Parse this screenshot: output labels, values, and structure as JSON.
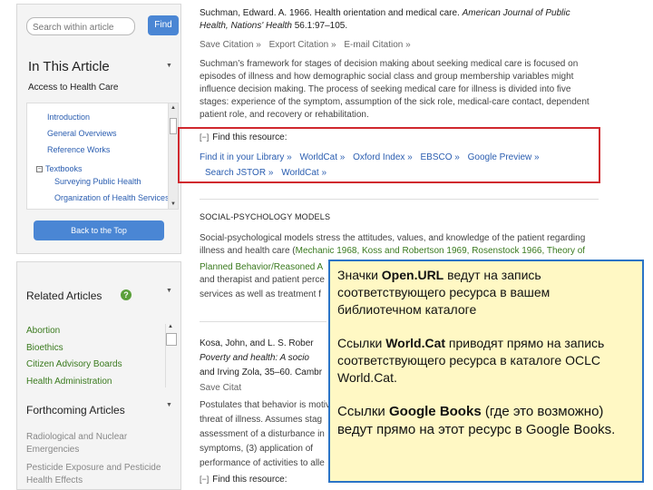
{
  "sidebar": {
    "search": {
      "placeholder": "Search within article",
      "button": "Find"
    },
    "article": {
      "heading": "In This Article",
      "subheading": "Access to Health Care",
      "toc": [
        {
          "label": "Introduction"
        },
        {
          "label": "General Overviews"
        },
        {
          "label": "Reference Works"
        },
        {
          "label": "Textbooks"
        },
        {
          "label": "Surveying Public Health"
        },
        {
          "label": "Organization of Health Services"
        }
      ],
      "back_to_top": "Back to the Top"
    },
    "related": {
      "heading": "Related Articles",
      "items": [
        "Abortion",
        "Bioethics",
        "Citizen Advisory Boards",
        "Health Administration"
      ],
      "forthcoming_heading": "Forthcoming Articles",
      "forthcoming_items": [
        "Radiological and Nuclear Emergencies",
        "Pesticide Exposure and Pesticide Health Effects"
      ]
    }
  },
  "main": {
    "ref1": {
      "text_a": "Suchman, Edward. A. 1966. Health orientation and medical care. ",
      "text_b": "American Journal of Public Health, Nations' Health",
      "text_c": " 56.1:97–105."
    },
    "actions": [
      "Save Citation »",
      "Export Citation »",
      "E-mail Citation »"
    ],
    "para1": "Suchman’s framework for stages of decision making about seeking medical care is focused on episodes of illness and how demographic social class and group membership variables might influence decision making. The process of seeking medical care for illness is divided into five stages: experience of the symptom, assumption of the sick role, medical-care contact, dependent patient role, and recovery or rehabilitation.",
    "find_resource": "Find this resource:",
    "resource_links": [
      "Find it in your Library »",
      "WorldCat »",
      "Oxford Index »",
      "EBSCO »",
      "Google Preview »",
      "Search JSTOR »",
      "WorldCat »"
    ],
    "section_title": "SOCIAL-PSYCHOLOGY MODELS",
    "para2_a": "Social-psychological models stress the attitudes, values, and knowledge of the patient regarding illness and health care (",
    "para2_link": "Mechanic 1968, Koss and Robertson 1969, Rosenstock 1966, Theory of",
    "para2_line3": "Planned Behavior/Reasoned A",
    "para2_line4": "and therapist and patient perce",
    "para2_line5": "services as well as treatment f",
    "ref2_a": "Kosa, John, and L. S. Rober",
    "ref2_b": "Poverty and health: A socio",
    "ref2_c": "and Irving Zola, 35–60. Cambr",
    "ref2_action": "Save Citat",
    "para3_lines": [
      "Postulates that behavior is motiv",
      "threat of illness. Assumes stag",
      "assessment of a disturbance in",
      "symptoms, (3) application of",
      "performance of activities to alle"
    ],
    "find_resource2": "Find this resource:"
  },
  "annotation": {
    "p1_a": "Значки ",
    "p1_b": "Open.URL",
    "p1_c": " ведут на запись соответствующего ресурса в вашем библиотечном каталоге",
    "p2_a": "Ссылки ",
    "p2_b": "World.Cat",
    "p2_c": " приводят прямо на запись соответствующего ресурса в каталоге OCLC World.Cat.",
    "p3_a": "Ссылки ",
    "p3_b": "Google Books",
    "p3_c": " (где это возможно) ведут прямо на этот ресурс в Google Books."
  },
  "colors": {
    "accent_blue": "#4a86d4",
    "link_green": "#3a7a1e",
    "highlight_red": "#d0282e",
    "note_bg": "#fff8c4",
    "note_border": "#2b74c6"
  }
}
